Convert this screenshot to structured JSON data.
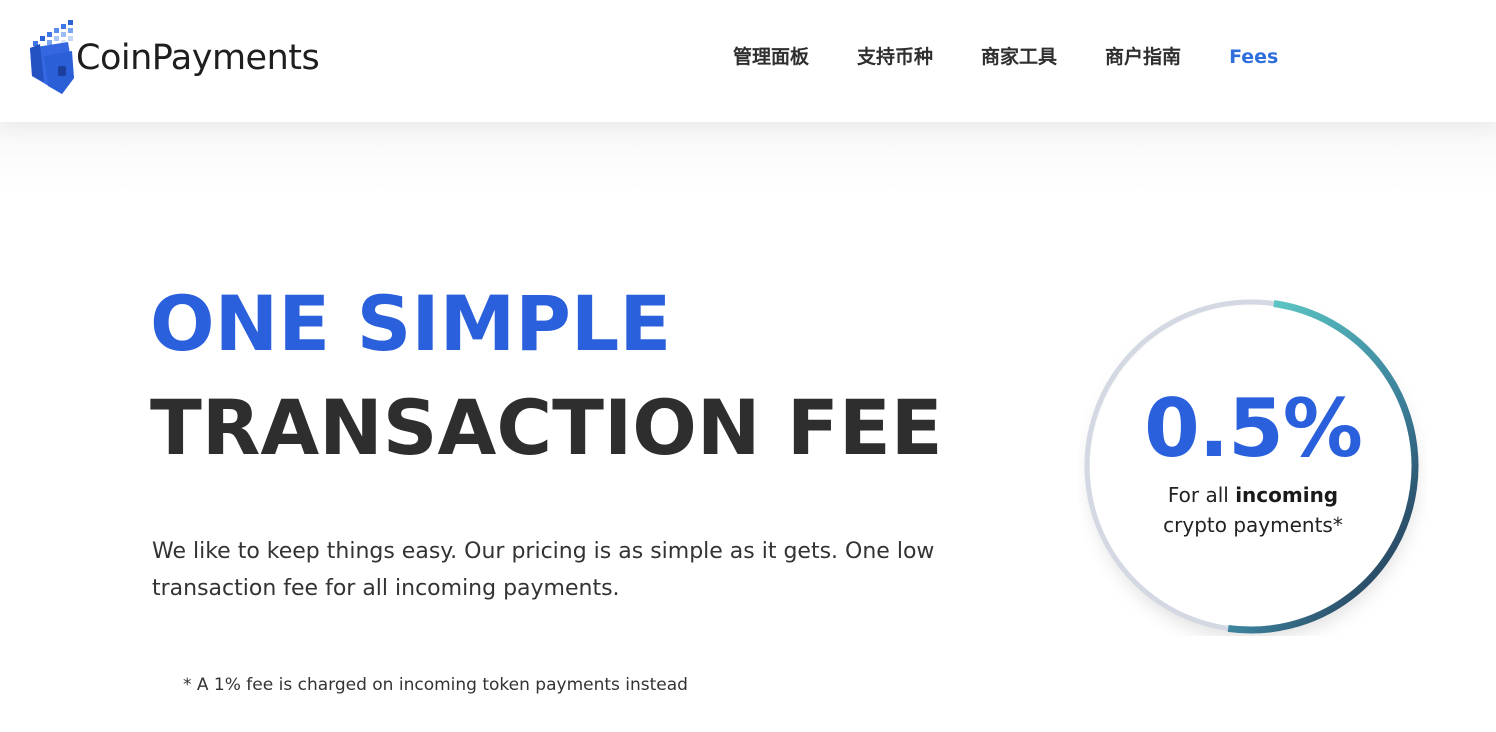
{
  "header": {
    "brand": "CoinPayments",
    "nav": [
      {
        "label": "管理面板",
        "active": false
      },
      {
        "label": "支持币种",
        "active": false
      },
      {
        "label": "商家工具",
        "active": false
      },
      {
        "label": "商户指南",
        "active": false
      },
      {
        "label": "Fees",
        "active": true
      }
    ]
  },
  "hero": {
    "headline_line1": "ONE SIMPLE",
    "headline_line2": "TRANSACTION FEE",
    "description": "We like to keep things easy. Our pricing is as simple as it gets. One low transaction fee for all incoming payments.",
    "footnote": "* A 1% fee is charged on incoming token payments instead"
  },
  "fee_badge": {
    "value": "0.5%",
    "caption_prefix": "For all ",
    "caption_bold": "incoming",
    "caption_suffix": "crypto payments*"
  },
  "colors": {
    "accent_blue": "#2b60dc",
    "nav_active": "#2f6fdc",
    "ring_teal": "#5bc3c3",
    "ring_navy": "#1f2a44",
    "ring_grey": "#d3d8e2",
    "text_dark": "#2e2e2e"
  }
}
